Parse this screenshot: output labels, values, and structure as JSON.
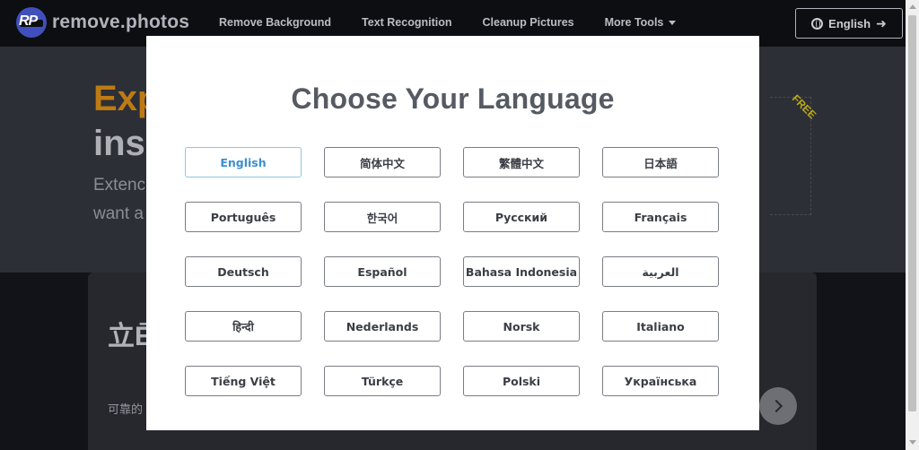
{
  "header": {
    "logo_mark": "RP",
    "logo_text": "remove.photos",
    "nav": [
      "Remove Background",
      "Text Recognition",
      "Cleanup Pictures",
      "More Tools"
    ],
    "language_button": "English",
    "icons": {
      "language": "globe-icon",
      "arrow": "arrow-right-icon",
      "more": "caret-down-icon"
    }
  },
  "hero": {
    "line1": "Exp",
    "line2": "ins",
    "sub1": "Extenc",
    "sub2": "want a",
    "free_tag": "FREE"
  },
  "card": {
    "title": "立Ē",
    "subtitle": "可靠的"
  },
  "modal": {
    "title": "Choose Your Language",
    "selected": "English",
    "languages": [
      "English",
      "简体中文",
      "繁體中文",
      "日本語",
      "Português",
      "한국어",
      "Русский",
      "Français",
      "Deutsch",
      "Español",
      "Bahasa Indonesia",
      "العربية",
      "हिन्दी",
      "Nederlands",
      "Norsk",
      "Italiano",
      "Tiếng Việt",
      "Türkçe",
      "Polski",
      "Українська"
    ]
  },
  "colors": {
    "accent_hero": "#d98b16",
    "free_tag": "#d8c21a",
    "selected_lang": "#3a8fd0"
  }
}
